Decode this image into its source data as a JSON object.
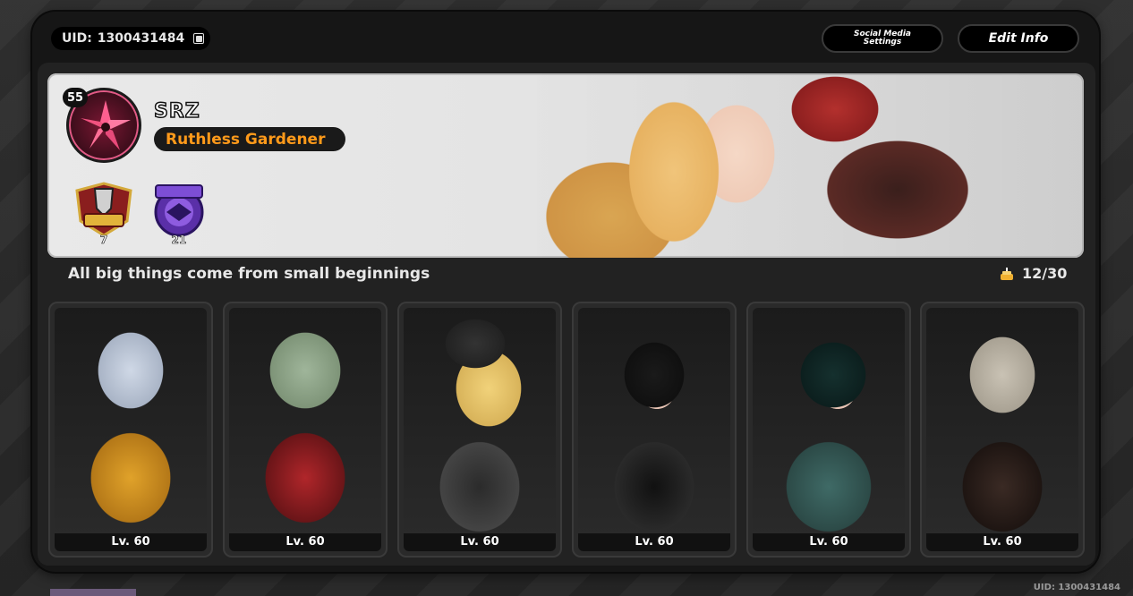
{
  "header": {
    "uid_label": "UID:",
    "uid_value": "1300431484",
    "social_media_settings_label": "Social Media Settings",
    "edit_info_label": "Edit Info"
  },
  "profile": {
    "level": "55",
    "name": "SRZ",
    "title": "Ruthless Gardener",
    "signature": "All big things come from small beginnings",
    "achievements": "12/30",
    "medals": [
      {
        "icon": "shiyu-defense-medal-icon",
        "value": "7"
      },
      {
        "icon": "master-medal-icon",
        "value": "21"
      }
    ]
  },
  "agents": [
    {
      "level": "Lv. 60"
    },
    {
      "level": "Lv. 60"
    },
    {
      "level": "Lv. 60"
    },
    {
      "level": "Lv. 60"
    },
    {
      "level": "Lv. 60"
    },
    {
      "level": "Lv. 60"
    }
  ],
  "footer": {
    "uid_text": "UID: 1300431484"
  },
  "colors": {
    "title_text": "#ff9a1a",
    "panel_bg": "#161616",
    "banner_bg": "#e6e6e6"
  }
}
